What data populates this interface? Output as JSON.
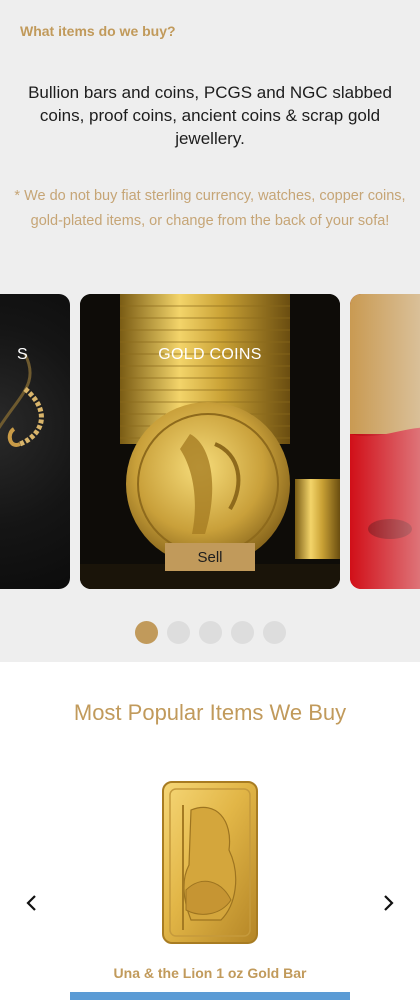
{
  "info": {
    "heading": "What items do we buy?",
    "intro": "Bullion bars and coins, PCGS and NGC slabbed coins, proof coins, ancient coins & scrap gold jewellery.",
    "disclaimer": "* We do not buy fiat sterling currency, watches, copper coins, gold-plated items, or change from the back of your sofa!"
  },
  "carousel": {
    "cards": [
      {
        "title": "S"
      },
      {
        "title": "GOLD COINS",
        "button": "Sell"
      }
    ],
    "dots": {
      "count": 5,
      "active_index": 0
    }
  },
  "popular": {
    "heading": "Most Popular Items We Buy",
    "product_name": "Una & the Lion 1 oz Gold Bar"
  },
  "colors": {
    "accent": "#c19a5b",
    "panel": "#eeeeee",
    "button_blue": "#5b9bd5"
  },
  "icons": {
    "prev": "chevron-left-icon",
    "next": "chevron-right-icon"
  }
}
